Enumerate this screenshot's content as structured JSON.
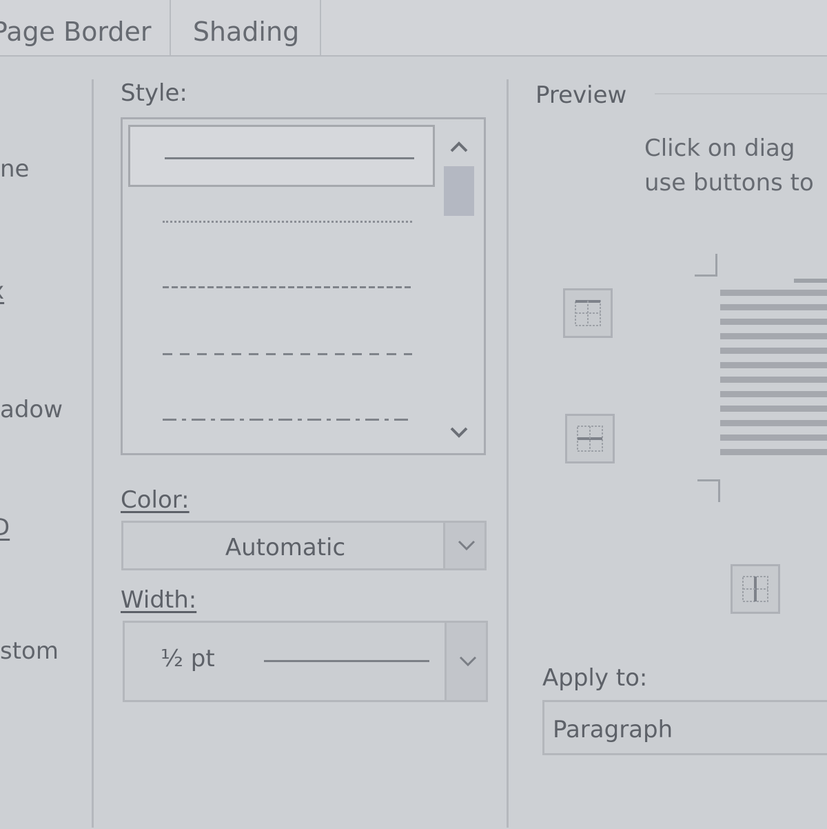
{
  "tabs": [
    {
      "label": "Page Border"
    },
    {
      "label": "Shading"
    }
  ],
  "setting": {
    "items": [
      {
        "label": "ne"
      },
      {
        "label": "x"
      },
      {
        "label": "adow"
      },
      {
        "label": "D"
      },
      {
        "label": "stom"
      }
    ]
  },
  "style": {
    "label": "Style:",
    "options": [
      "solid",
      "dotted",
      "fine-dash",
      "dash",
      "dash-dot"
    ],
    "selected": "solid"
  },
  "color": {
    "label": "Color:",
    "value": "Automatic"
  },
  "width": {
    "label": "Width:",
    "value": "½ pt"
  },
  "preview": {
    "label": "Preview",
    "hint_line1": "Click on diag",
    "hint_line2": "use buttons to"
  },
  "apply_to": {
    "label": "Apply to:",
    "value": "Paragraph"
  },
  "icons": {
    "scroll_up": "chevron-up-icon",
    "scroll_down": "chevron-down-icon",
    "dropdown": "chevron-down-icon",
    "border_buttons": [
      "top-border-icon",
      "inside-horizontal-border-icon",
      "inside-vertical-border-icon"
    ]
  }
}
